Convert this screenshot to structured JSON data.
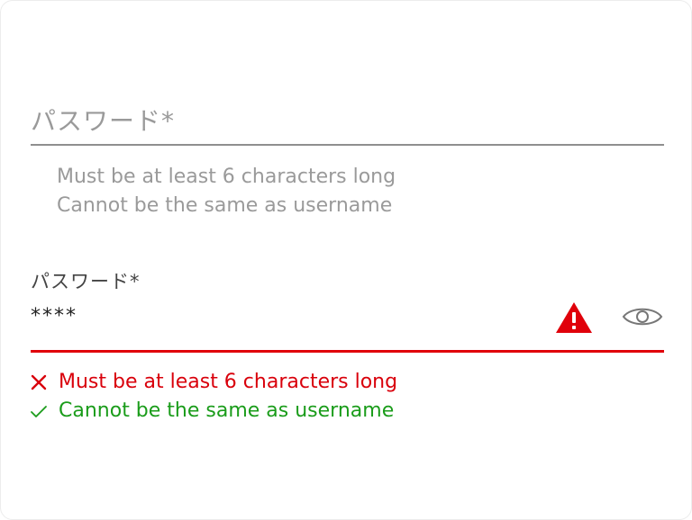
{
  "password_field_empty": {
    "label": "パスワード*",
    "hints": [
      "Must be at least 6 characters long",
      "Cannot be the same as username"
    ]
  },
  "password_field_error": {
    "label": "パスワード*",
    "value": "****",
    "warning_icon": "warning-triangle-icon",
    "toggle_icon": "eye-icon",
    "rules": [
      {
        "text": "Must be at least 6 characters long",
        "status": "fail",
        "icon": "cross-icon"
      },
      {
        "text": "Cannot be the same as username",
        "status": "pass",
        "icon": "check-icon"
      }
    ]
  },
  "colors": {
    "error": "#e0000a",
    "success": "#1a9c1a",
    "muted": "#9a9a9a"
  }
}
